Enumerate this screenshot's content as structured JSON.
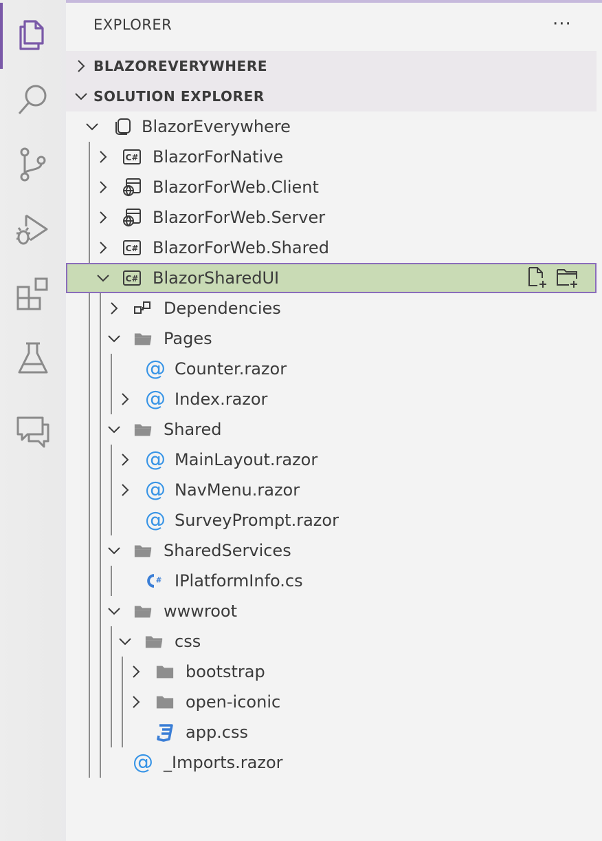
{
  "activity_bar": {
    "items": [
      {
        "name": "explorer-icon"
      },
      {
        "name": "search-icon"
      },
      {
        "name": "source-control-icon"
      },
      {
        "name": "run-debug-icon"
      },
      {
        "name": "extensions-icon"
      },
      {
        "name": "testing-icon"
      },
      {
        "name": "chat-icon"
      }
    ],
    "accent": "#7a59a8"
  },
  "sidebar": {
    "title": "EXPLORER",
    "more_label": "···",
    "sections": [
      {
        "label": "BLAZOREVERYWHERE",
        "expanded": false
      },
      {
        "label": "SOLUTION EXPLORER",
        "expanded": true
      }
    ]
  },
  "tree": {
    "solution": {
      "label": "BlazorEverywhere"
    },
    "projects": [
      {
        "label": "BlazorForNative",
        "icon": "csharp-project-icon"
      },
      {
        "label": "BlazorForWeb.Client",
        "icon": "web-project-icon"
      },
      {
        "label": "BlazorForWeb.Server",
        "icon": "web-project-icon"
      },
      {
        "label": "BlazorForWeb.Shared",
        "icon": "csharp-project-icon"
      },
      {
        "label": "BlazorSharedUI",
        "icon": "csharp-project-icon",
        "selected": true
      }
    ],
    "shared_ui": {
      "dependencies": "Dependencies",
      "pages": {
        "label": "Pages",
        "files": [
          "Counter.razor",
          "Index.razor"
        ]
      },
      "shared": {
        "label": "Shared",
        "files": [
          "MainLayout.razor",
          "NavMenu.razor",
          "SurveyPrompt.razor"
        ]
      },
      "shared_services": {
        "label": "SharedServices",
        "files": [
          "IPlatformInfo.cs"
        ]
      },
      "wwwroot": {
        "label": "wwwroot",
        "css": {
          "label": "css",
          "folders": [
            "bootstrap",
            "open-iconic"
          ],
          "files": [
            "app.css"
          ]
        }
      },
      "imports": "_Imports.razor"
    }
  },
  "colors": {
    "selected_bg": "#c9dbb5",
    "selected_border": "#8a6dbb",
    "razor_icon": "#3794e6",
    "folder_icon": "#8e8e8e"
  }
}
